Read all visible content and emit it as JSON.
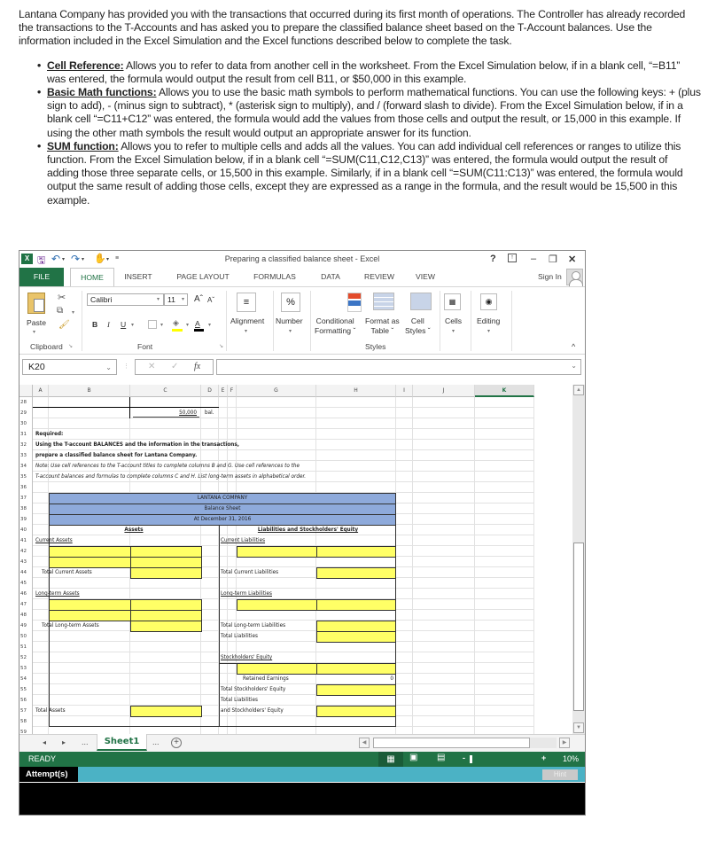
{
  "intro": {
    "paragraph": "Lantana Company has provided you with the transactions that occurred during its first month of operations.  The Controller has already recorded the transactions to the T-Accounts and has asked you to prepare the classified balance sheet based on the T-Account balances.  Use the information included in the Excel Simulation and the Excel functions described below to complete the task.",
    "bullets": [
      {
        "term": "Cell Reference:",
        "text": " Allows you to refer to data from another cell in the worksheet.  From the Excel Simulation below, if in a blank cell, “=B11” was entered, the formula would output the result from cell B11, or $50,000 in this example."
      },
      {
        "term": "Basic Math functions:",
        "text": " Allows you to use the basic math symbols to perform mathematical functions.  You can use the following keys:  + (plus sign to add), - (minus sign to subtract), * (asterisk sign to multiply), and / (forward slash to divide).  From the Excel Simulation below, if in a blank cell “=C11+C12” was entered, the formula would add the values from those cells and output the result, or 15,000 in this example.  If using the other math symbols the result would output an appropriate answer for its function."
      },
      {
        "term": "SUM function:",
        "text": " Allows you to refer to multiple cells and adds all the values.  You can add individual cell references or ranges to utilize this function.  From the Excel Simulation below, if in a blank cell “=SUM(C11,C12,C13)” was entered, the formula would output the result of adding those three separate cells, or 15,500 in this example.  Similarly, if in a blank cell “=SUM(C11:C13)” was entered, the formula would output the same result of adding those cells, except they are expressed as a range in the formula, and the result would be 15,500 in this example."
      }
    ]
  },
  "excel": {
    "title": "Preparing a classified balance sheet - Excel",
    "window_controls": {
      "help": "?",
      "ribbon_display": "↑",
      "minimize": "–",
      "restore": "❐",
      "close": "✕"
    },
    "tabs": [
      "FILE",
      "HOME",
      "INSERT",
      "PAGE LAYOUT",
      "FORMULAS",
      "DATA",
      "REVIEW",
      "VIEW"
    ],
    "active_tab": "HOME",
    "sign_in": "Sign In",
    "ribbon": {
      "paste": "Paste",
      "clipboard": "Clipboard",
      "font_name": "Calibri",
      "font_size": "11",
      "font_group": "Font",
      "bold": "B",
      "italic": "I",
      "underline": "U",
      "font_color": "A",
      "grow_font": "Aˆ",
      "shrink_font": "Aˇ",
      "alignment": "Alignment",
      "number": "Number",
      "percent": "%",
      "conditional_formatting": [
        "Conditional",
        "Formatting ˇ"
      ],
      "format_as_table": [
        "Format as",
        "Table ˇ"
      ],
      "cell_styles": [
        "Cell",
        "Styles ˇ"
      ],
      "styles_group": "Styles",
      "cells": "Cells",
      "editing": "Editing",
      "collapse": "^"
    },
    "name_box": "K20",
    "formula_value": "",
    "fx": "fx",
    "columns": [
      "A",
      "B",
      "C",
      "D",
      "E",
      "F",
      "G",
      "H",
      "I",
      "J",
      "K"
    ],
    "selected_column": "K",
    "rows": [
      "28",
      "29",
      "30",
      "31",
      "32",
      "33",
      "34",
      "35",
      "36",
      "37",
      "38",
      "39",
      "40",
      "41",
      "42",
      "43",
      "44",
      "45",
      "46",
      "47",
      "48",
      "49",
      "50",
      "51",
      "52",
      "53",
      "54",
      "55",
      "56",
      "57",
      "58",
      "59"
    ],
    "cells": {
      "c29": "50,000",
      "d29": "bal.",
      "b31": "Required:",
      "b32": "Using the T-account BALANCES and the information in the transactions,",
      "b33": "prepare a classified balance sheet for Lantana Company.",
      "b34": "Note: Use cell references to the T-account titles to complete columns B and G.  Use cell references to the",
      "b35": "T-account balances and formulas to complete columns C and H.  List long-term assets in alphabetical order.",
      "header1": "LANTANA COMPANY",
      "header2": "Balance Sheet",
      "header3": "At December 31, 2016",
      "assets": "Assets",
      "liab_equity": "Liabilities and Stockholders' Equity",
      "current_assets": "Current Assets",
      "current_liabilities": "Current Liabilities",
      "total_current_assets": "Total Current Assets",
      "total_current_liabilities": "Total Current Liabilities",
      "long_term_assets": "Long-term Assets",
      "long_term_liabilities": "Long-term Liabilities",
      "total_long_term_assets": "Total Long-term Assets",
      "total_long_term_liabilities": "Total Long-term Liabilities",
      "total_liabilities": "Total Liabilities",
      "stockholders_equity": "Stockholders' Equity",
      "retained_earnings": "Retained Earnings",
      "retained_earnings_value": "0",
      "total_se": "Total Stockholders' Equity",
      "total_liab_line1": "Total Liabilities",
      "total_liab_line2": "and Stockholders' Equity",
      "total_assets": "Total Assets"
    },
    "sheet_nav": {
      "prev": "◂",
      "next": "▸",
      "more_left": "...",
      "sheet": "Sheet1",
      "more_right": "...",
      "add": "+"
    },
    "status": {
      "ready": "READY",
      "zoom_minus": "-",
      "zoom_plus": "+",
      "zoom": "10%"
    },
    "attempt": "Attempt(s)",
    "hint": "Hint"
  }
}
